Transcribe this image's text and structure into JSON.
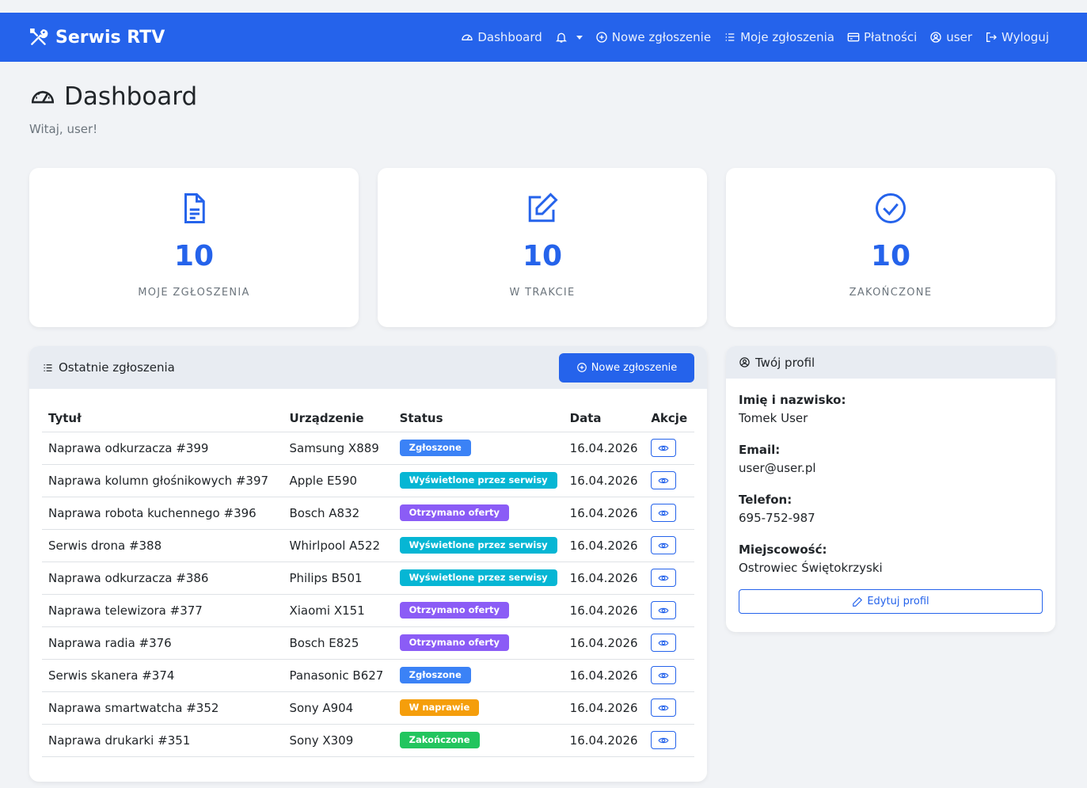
{
  "nav": {
    "brand": "Serwis RTV",
    "items": [
      {
        "label": "Dashboard",
        "icon": "speedometer-icon"
      },
      {
        "label": "",
        "icon": "bell-icon"
      },
      {
        "label": "Nowe zgłoszenie",
        "icon": "plus-circle-icon"
      },
      {
        "label": "Moje zgłoszenia",
        "icon": "list-icon"
      },
      {
        "label": "Płatności",
        "icon": "credit-card-icon"
      },
      {
        "label": "user",
        "icon": "user-circle-icon"
      },
      {
        "label": "Wyloguj",
        "icon": "logout-icon"
      }
    ]
  },
  "page": {
    "title": "Dashboard",
    "subtitle": "Witaj, user!"
  },
  "stats": [
    {
      "value": "10",
      "label": "MOJE ZGŁOSZENIA",
      "icon": "document-icon"
    },
    {
      "value": "10",
      "label": "W TRAKCIE",
      "icon": "edit-icon"
    },
    {
      "value": "10",
      "label": "ZAKOŃCZONE",
      "icon": "check-circle-icon"
    }
  ],
  "recent": {
    "title": "Ostatnie zgłoszenia",
    "new_button": "Nowe zgłoszenie",
    "columns": [
      "Tytuł",
      "Urządzenie",
      "Status",
      "Data",
      "Akcje"
    ],
    "rows": [
      {
        "title": "Naprawa odkurzacza #399",
        "device": "Samsung X889",
        "status": "Zgłoszone",
        "status_color": "#3b82f6",
        "date": "16.04.2026"
      },
      {
        "title": "Naprawa kolumn głośnikowych #397",
        "device": "Apple E590",
        "status": "Wyświetlone przez serwisy",
        "status_color": "#06b6d4",
        "date": "16.04.2026"
      },
      {
        "title": "Naprawa robota kuchennego #396",
        "device": "Bosch A832",
        "status": "Otrzymano oferty",
        "status_color": "#8b5cf6",
        "date": "16.04.2026"
      },
      {
        "title": "Serwis drona #388",
        "device": "Whirlpool A522",
        "status": "Wyświetlone przez serwisy",
        "status_color": "#06b6d4",
        "date": "16.04.2026"
      },
      {
        "title": "Naprawa odkurzacza #386",
        "device": "Philips B501",
        "status": "Wyświetlone przez serwisy",
        "status_color": "#06b6d4",
        "date": "16.04.2026"
      },
      {
        "title": "Naprawa telewizora #377",
        "device": "Xiaomi X151",
        "status": "Otrzymano oferty",
        "status_color": "#8b5cf6",
        "date": "16.04.2026"
      },
      {
        "title": "Naprawa radia #376",
        "device": "Bosch E825",
        "status": "Otrzymano oferty",
        "status_color": "#8b5cf6",
        "date": "16.04.2026"
      },
      {
        "title": "Serwis skanera #374",
        "device": "Panasonic B627",
        "status": "Zgłoszone",
        "status_color": "#3b82f6",
        "date": "16.04.2026"
      },
      {
        "title": "Naprawa smartwatcha #352",
        "device": "Sony A904",
        "status": "W naprawie",
        "status_color": "#f59e0b",
        "date": "16.04.2026"
      },
      {
        "title": "Naprawa drukarki #351",
        "device": "Sony X309",
        "status": "Zakończone",
        "status_color": "#22c55e",
        "date": "16.04.2026"
      }
    ]
  },
  "profile": {
    "title": "Twój profil",
    "fields": [
      {
        "label": "Imię i nazwisko:",
        "value": "Tomek User"
      },
      {
        "label": "Email:",
        "value": "user@user.pl"
      },
      {
        "label": "Telefon:",
        "value": "695-752-987"
      },
      {
        "label": "Miejscowość:",
        "value": "Ostrowiec Świętokrzyski"
      }
    ],
    "edit_button": "Edytuj profil"
  },
  "colors": {
    "primary": "#2563eb",
    "background": "#f1f3f6",
    "card_header": "#e8ecf2"
  }
}
